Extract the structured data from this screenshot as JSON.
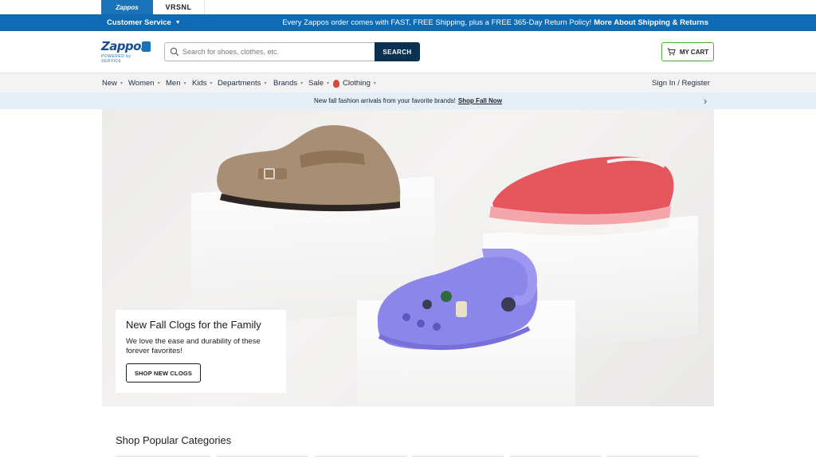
{
  "brand_tabs": {
    "zappos": "Zappos",
    "vrsnl": "VRSNL"
  },
  "promo_bar": {
    "customer_service": "Customer Service",
    "text": "Every Zappos order comes with FAST, FREE Shipping, plus a FREE 365-Day Return Policy!",
    "link": "More About Shipping & Returns"
  },
  "header": {
    "logo_text": "Zappos",
    "logo_sub": "POWERED by SERVICE",
    "search_placeholder": "Search for shoes, clothes, etc.",
    "search_button": "SEARCH",
    "cart_button": "MY CART"
  },
  "nav": {
    "items": [
      {
        "label": "New"
      },
      {
        "label": "Women"
      },
      {
        "label": "Men"
      },
      {
        "label": "Kids"
      },
      {
        "label": "Departments"
      },
      {
        "label": "Brands"
      },
      {
        "label": "Sale"
      },
      {
        "label": "Clothing"
      }
    ],
    "signin": "Sign In / Register"
  },
  "announcement": {
    "text": "New fall fashion arrivals from your favorite brands!",
    "link": "Shop Fall Now"
  },
  "hero": {
    "title": "New Fall Clogs for the Family",
    "body": "We love the ease and durability of these forever favorites!",
    "cta": "SHOP NEW CLOGS"
  },
  "section": {
    "title": "Shop Popular Categories"
  },
  "colors": {
    "brand_blue": "#0f6ab4",
    "search_button": "#0b3150",
    "cart_border": "#4fae3d",
    "announcement_bg": "#e4eef7"
  }
}
